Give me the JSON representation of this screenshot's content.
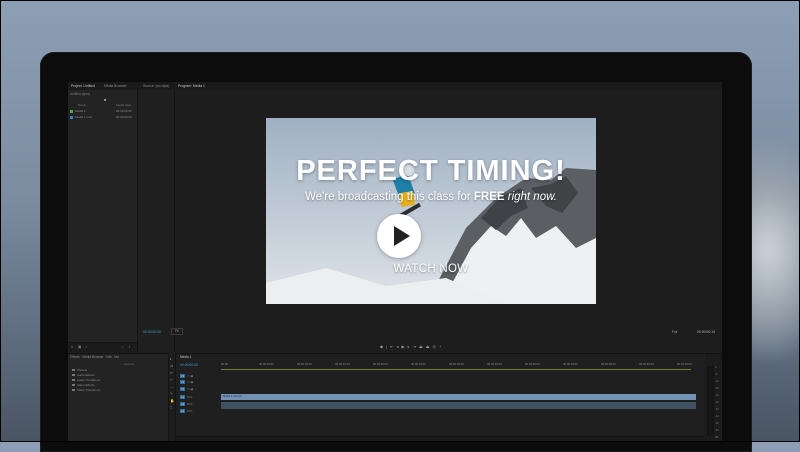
{
  "app": {
    "tabs": [
      "Project: Untitled",
      "Media Browser",
      "Source: (no clips)",
      "Program: Media 1"
    ],
    "project_panel": {
      "title": "Untitled.prproj",
      "columns": [
        "Name",
        "Media Start"
      ],
      "items": [
        {
          "name": "Media 1",
          "value": "00:00:00:00",
          "color": "#3fae49"
        },
        {
          "name": "Media 1.mov",
          "value": "00:00:00:00",
          "color": "#2a8cc2"
        }
      ]
    },
    "program": {
      "timecode_left": "00:00:00:00",
      "fit": "Fit",
      "full": "Full",
      "timecode_right": "00:00:00:14"
    },
    "effects_panel": {
      "tabs": [
        "Effects",
        "Media Browser",
        "Info",
        "Ma"
      ],
      "items": [
        "Presets",
        "Audio Effects",
        "Audio Transitions",
        "Video Effects",
        "Video Transitions"
      ]
    },
    "timeline": {
      "tab": "Media 1",
      "timecode": "00:00:00:00",
      "ruler": [
        "00:00",
        "00:00:05:00",
        "00:00:10:00",
        "00:00:15:00",
        "00:00:20:00",
        "00:00:25:00",
        "00:00:30:00",
        "00:00:35:00",
        "00:00:40:00",
        "00:00:45:00",
        "00:00:50:00",
        "00:00:55:00",
        "00:01:00:00"
      ],
      "tracks": [
        "V3",
        "V2",
        "V1",
        "A1",
        "A2",
        "A3"
      ],
      "clip_label": "Media 1.mov [V]",
      "meter_labels": [
        "0",
        "-6",
        "-12",
        "-18",
        "-24",
        "-30",
        "-36",
        "-42",
        "-48",
        "-54",
        "dB"
      ]
    }
  },
  "overlay": {
    "headline": "PERFECT TIMING!",
    "sub_prefix": "We're broadcasting this class for",
    "sub_bold": "FREE",
    "sub_italic": "right now.",
    "cta": "WATCH NOW"
  },
  "colors": {
    "accent_timecode": "#3ea1d9",
    "clip_video": "#7391b3",
    "play_button": "#ffffff"
  },
  "icons": [
    "play-icon"
  ]
}
